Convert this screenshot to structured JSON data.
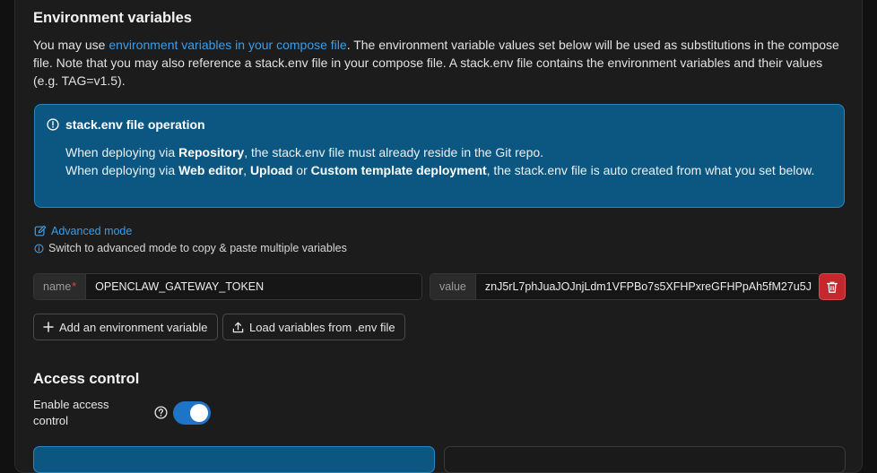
{
  "env": {
    "title": "Environment variables",
    "desc_prefix": "You may use ",
    "desc_link": "environment variables in your compose file",
    "desc_suffix": ". The environment variable values set below will be used as substitutions in the compose file. Note that you may also reference a stack.env file in your compose file. A stack.env file contains the environment variables and their values (e.g. TAG=v1.5).",
    "info": {
      "title": "stack.env file operation",
      "l1_a": "When deploying via ",
      "l1_b": "Repository",
      "l1_c": ", the stack.env file must already reside in the Git repo.",
      "l2_a": "When deploying via ",
      "l2_b": "Web editor",
      "l2_c": ", ",
      "l2_d": "Upload",
      "l2_e": " or ",
      "l2_f": "Custom template deployment",
      "l2_g": ", the stack.env file is auto created from what you set below."
    },
    "advanced_mode": "Advanced mode",
    "advanced_hint": "Switch to advanced mode to copy & paste multiple variables",
    "variable": {
      "name_label": "name",
      "name_value": "OPENCLAW_GATEWAY_TOKEN",
      "value_label": "value",
      "value_value": "znJ5rL7phJuaJOJnjLdm1VFPBo7s5XFHPxreGFHPpAh5fM27u5J"
    },
    "add_button": "Add an environment variable",
    "load_button": "Load variables from .env file"
  },
  "access": {
    "title": "Access control",
    "enable_label": "Enable access control",
    "enabled": true
  },
  "colors": {
    "accent": "#1e74c6",
    "link": "#3b9de8",
    "info_bg": "#0c5782",
    "danger": "#c4282d"
  }
}
